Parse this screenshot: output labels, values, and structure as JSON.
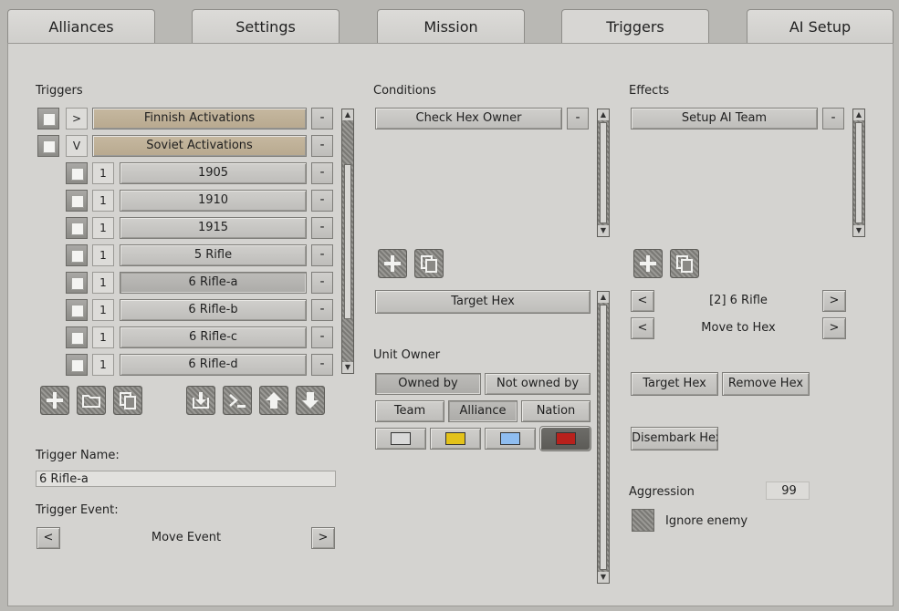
{
  "tabs": [
    "Alliances",
    "Settings",
    "Mission",
    "Triggers",
    "AI Setup"
  ],
  "triggers": {
    "heading": "Triggers",
    "groups": [
      {
        "expander": ">",
        "label": "Finnish Activations"
      },
      {
        "expander": "V",
        "label": "Soviet Activations"
      }
    ],
    "items": [
      {
        "count": "1",
        "label": "1905"
      },
      {
        "count": "1",
        "label": "1910"
      },
      {
        "count": "1",
        "label": "1915"
      },
      {
        "count": "1",
        "label": "5 Rifle"
      },
      {
        "count": "1",
        "label": "6 Rifle-a"
      },
      {
        "count": "1",
        "label": "6 Rifle-b"
      },
      {
        "count": "1",
        "label": "6 Rifle-c"
      },
      {
        "count": "1",
        "label": "6 Rifle-d"
      }
    ],
    "remove_label": "-",
    "name_label": "Trigger Name:",
    "name_value": "6 Rifle-a",
    "event_label": "Trigger Event:",
    "event_value": "Move Event",
    "prev": "<",
    "next": ">"
  },
  "conditions": {
    "heading": "Conditions",
    "items": [
      {
        "label": "Check Hex Owner"
      }
    ],
    "target_hex": "Target Hex",
    "unit_owner_label": "Unit Owner",
    "owned_by": "Owned by",
    "not_owned_by": "Not owned by",
    "team": "Team",
    "alliance": "Alliance",
    "nation": "Nation",
    "swatches": [
      "#d9d9d9",
      "#e3c21a",
      "#8fbdf0",
      "#b8211c"
    ]
  },
  "effects": {
    "heading": "Effects",
    "items": [
      {
        "label": "Setup AI Team"
      }
    ],
    "unit_value": "[2] 6 Rifle",
    "action_value": "Move to Hex",
    "target_hex": "Target Hex",
    "remove_hex": "Remove Hex",
    "disembark_hex": "Disembark Hex",
    "aggression_label": "Aggression",
    "aggression_value": "99",
    "ignore_enemy": "Ignore enemy",
    "prev": "<",
    "next": ">"
  }
}
